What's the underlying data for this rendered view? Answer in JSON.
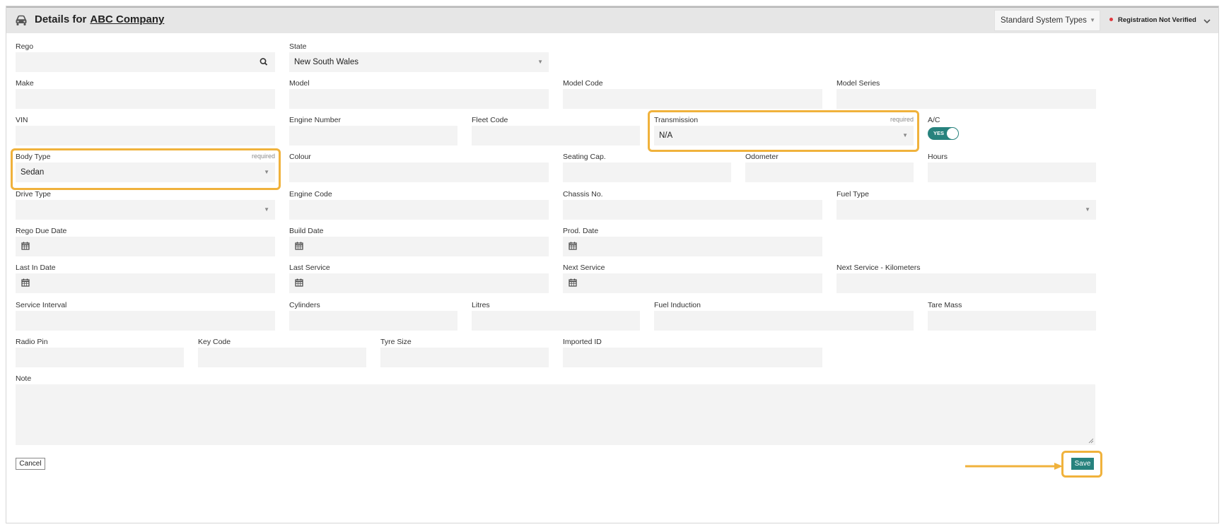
{
  "header": {
    "title_prefix": "Details for",
    "company": "ABC Company",
    "system_type": "Standard System Types",
    "registration_status": "Registration Not Verified"
  },
  "fields": {
    "rego": {
      "label": "Rego",
      "value": ""
    },
    "state": {
      "label": "State",
      "value": "New South Wales"
    },
    "make": {
      "label": "Make",
      "value": ""
    },
    "model": {
      "label": "Model",
      "value": ""
    },
    "model_code": {
      "label": "Model Code",
      "value": ""
    },
    "model_series": {
      "label": "Model Series",
      "value": ""
    },
    "vin": {
      "label": "VIN",
      "value": ""
    },
    "engine_number": {
      "label": "Engine Number",
      "value": ""
    },
    "fleet_code": {
      "label": "Fleet Code",
      "value": ""
    },
    "transmission": {
      "label": "Transmission",
      "required": "required",
      "value": "N/A"
    },
    "ac": {
      "label": "A/C",
      "toggle": "YES"
    },
    "body_type": {
      "label": "Body Type",
      "required": "required",
      "value": "Sedan"
    },
    "colour": {
      "label": "Colour",
      "value": ""
    },
    "seating_cap": {
      "label": "Seating Cap.",
      "value": ""
    },
    "odometer": {
      "label": "Odometer",
      "value": ""
    },
    "hours": {
      "label": "Hours",
      "value": ""
    },
    "drive_type": {
      "label": "Drive Type",
      "value": ""
    },
    "engine_code": {
      "label": "Engine Code",
      "value": ""
    },
    "chassis_no": {
      "label": "Chassis No.",
      "value": ""
    },
    "fuel_type": {
      "label": "Fuel Type",
      "value": ""
    },
    "rego_due_date": {
      "label": "Rego Due Date",
      "value": ""
    },
    "build_date": {
      "label": "Build Date",
      "value": ""
    },
    "prod_date": {
      "label": "Prod. Date",
      "value": ""
    },
    "last_in_date": {
      "label": "Last In Date",
      "value": ""
    },
    "last_service": {
      "label": "Last Service",
      "value": ""
    },
    "next_service": {
      "label": "Next Service",
      "value": ""
    },
    "next_service_km": {
      "label": "Next Service - Kilometers",
      "value": ""
    },
    "service_interval": {
      "label": "Service Interval",
      "value": ""
    },
    "cylinders": {
      "label": "Cylinders",
      "value": ""
    },
    "litres": {
      "label": "Litres",
      "value": ""
    },
    "fuel_induction": {
      "label": "Fuel Induction",
      "value": ""
    },
    "tare_mass": {
      "label": "Tare Mass",
      "value": ""
    },
    "radio_pin": {
      "label": "Radio Pin",
      "value": ""
    },
    "key_code": {
      "label": "Key Code",
      "value": ""
    },
    "tyre_size": {
      "label": "Tyre Size",
      "value": ""
    },
    "imported_id": {
      "label": "Imported ID",
      "value": ""
    },
    "note": {
      "label": "Note",
      "value": ""
    }
  },
  "actions": {
    "cancel": "Cancel",
    "save": "Save"
  },
  "icons": {
    "vehicle": "car-icon",
    "rego_search": "search-icon",
    "dates": "calendar-icon",
    "expand": "chevron-down-icon"
  },
  "colors": {
    "accent": "#27827d",
    "highlight": "#f0b23c",
    "status_dot": "#e0383e",
    "field_bg": "#f3f3f3",
    "header_bg": "#e6e6e6"
  }
}
